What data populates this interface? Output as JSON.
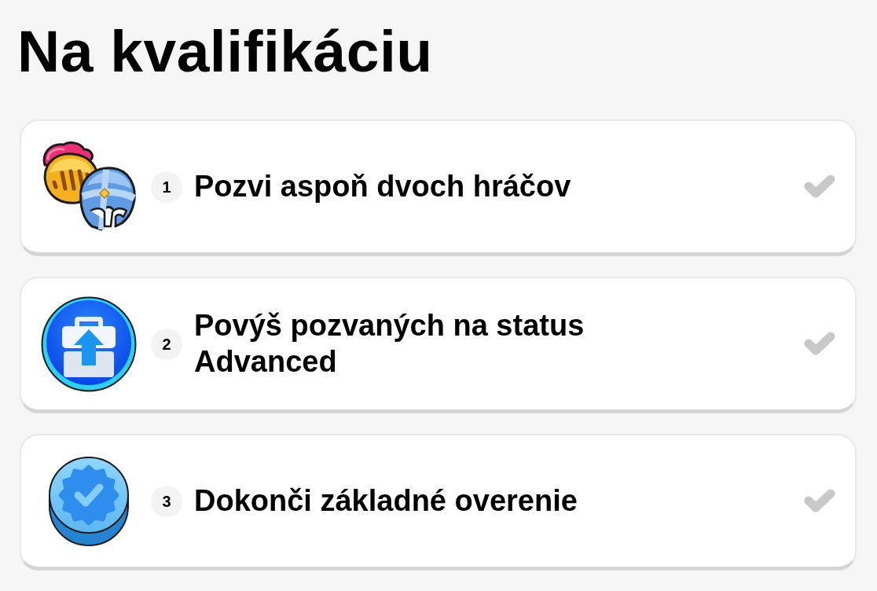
{
  "title": "Na kvalifikáciu",
  "steps": [
    {
      "number": "1",
      "label": "Pozvi aspoň dvoch hráčov",
      "completed": false
    },
    {
      "number": "2",
      "label": "Povýš pozvaných na status Advanced",
      "completed": false
    },
    {
      "number": "3",
      "label": "Dokonči základné overenie",
      "completed": false
    }
  ]
}
